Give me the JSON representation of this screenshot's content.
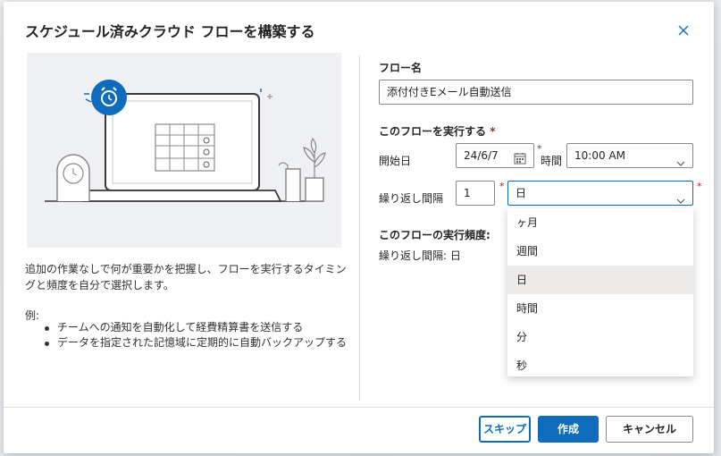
{
  "dialog": {
    "title": "スケジュール済みクラウド フローを構築する",
    "close_icon": "close-icon"
  },
  "left": {
    "description": "追加の作業なしで何が重要かを把握し、フローを実行するタイミングと頻度を自分で選択します。",
    "example_label": "例:",
    "examples": [
      "チームへの通知を自動化して経費精算書を送信する",
      "データを指定された記憶域に定期的に自動バックアップする"
    ]
  },
  "form": {
    "flow_name_label": "フロー名",
    "flow_name_value": "添付付きEメール自動送信",
    "run_section_label": "このフローを実行する",
    "required_mark": "*",
    "start_date_label": "開始日",
    "start_date_value": "24/6/7",
    "time_label": "時間",
    "time_value": "10:00 AM",
    "repeat_label": "繰り返し間隔",
    "repeat_value": "1",
    "repeat_unit_value": "日",
    "frequency_label": "このフローの実行頻度:",
    "frequency_text": "繰り返し間隔: 日"
  },
  "unit_menu": {
    "options": [
      "ヶ月",
      "週間",
      "日",
      "時間",
      "分",
      "秒"
    ],
    "selected": "日"
  },
  "footer": {
    "skip_label": "スキップ",
    "create_label": "作成",
    "cancel_label": "キャンセル"
  },
  "colors": {
    "accent": "#0f6cbd",
    "required": "#a4262c",
    "illustration_bg": "#eef0f3"
  }
}
